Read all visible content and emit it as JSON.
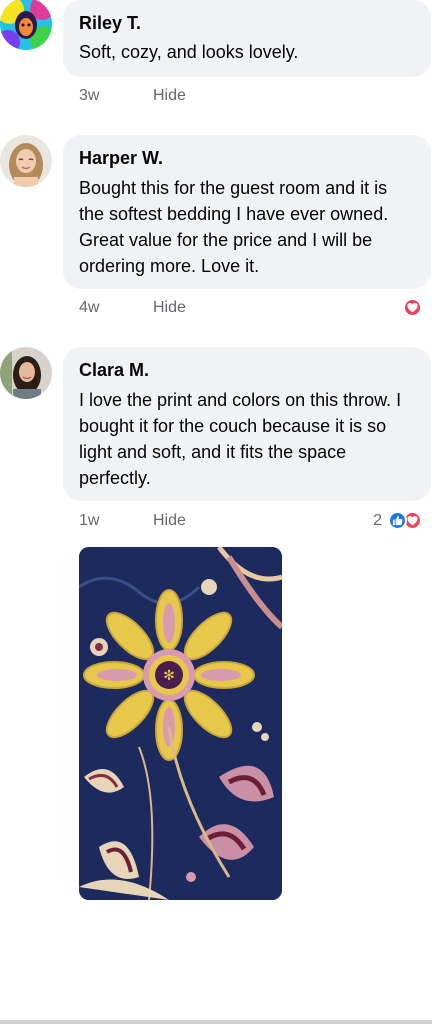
{
  "comments": [
    {
      "author": "Riley T.",
      "text": "Soft, cozy, and looks lovely.",
      "time": "3w",
      "action": "Hide",
      "reactions": null,
      "avatar_icon": "colorful-avatar"
    },
    {
      "author": "Harper W.",
      "text": "Bought this for the guest room and it is the softest bedding I have ever owned. Great value for the price and I will be ordering more. Love it.",
      "time": "4w",
      "action": "Hide",
      "reactions": {
        "types": [
          "love"
        ],
        "count": ""
      },
      "avatar_icon": "woman-portrait-avatar"
    },
    {
      "author": "Clara M.",
      "text": "I love the print and colors on this throw. I bought it for the couch because it is so light and soft, and it fits the space perfectly.",
      "time": "1w",
      "action": "Hide",
      "reactions": {
        "types": [
          "like",
          "love"
        ],
        "count": "2"
      },
      "avatar_icon": "woman-portrait-avatar",
      "attachment": "photo of floral print throw blanket"
    }
  ],
  "colors": {
    "bubble": "#f0f2f5",
    "meta_text": "#65676b",
    "like": "#1877f2",
    "love": "#f33e58"
  }
}
